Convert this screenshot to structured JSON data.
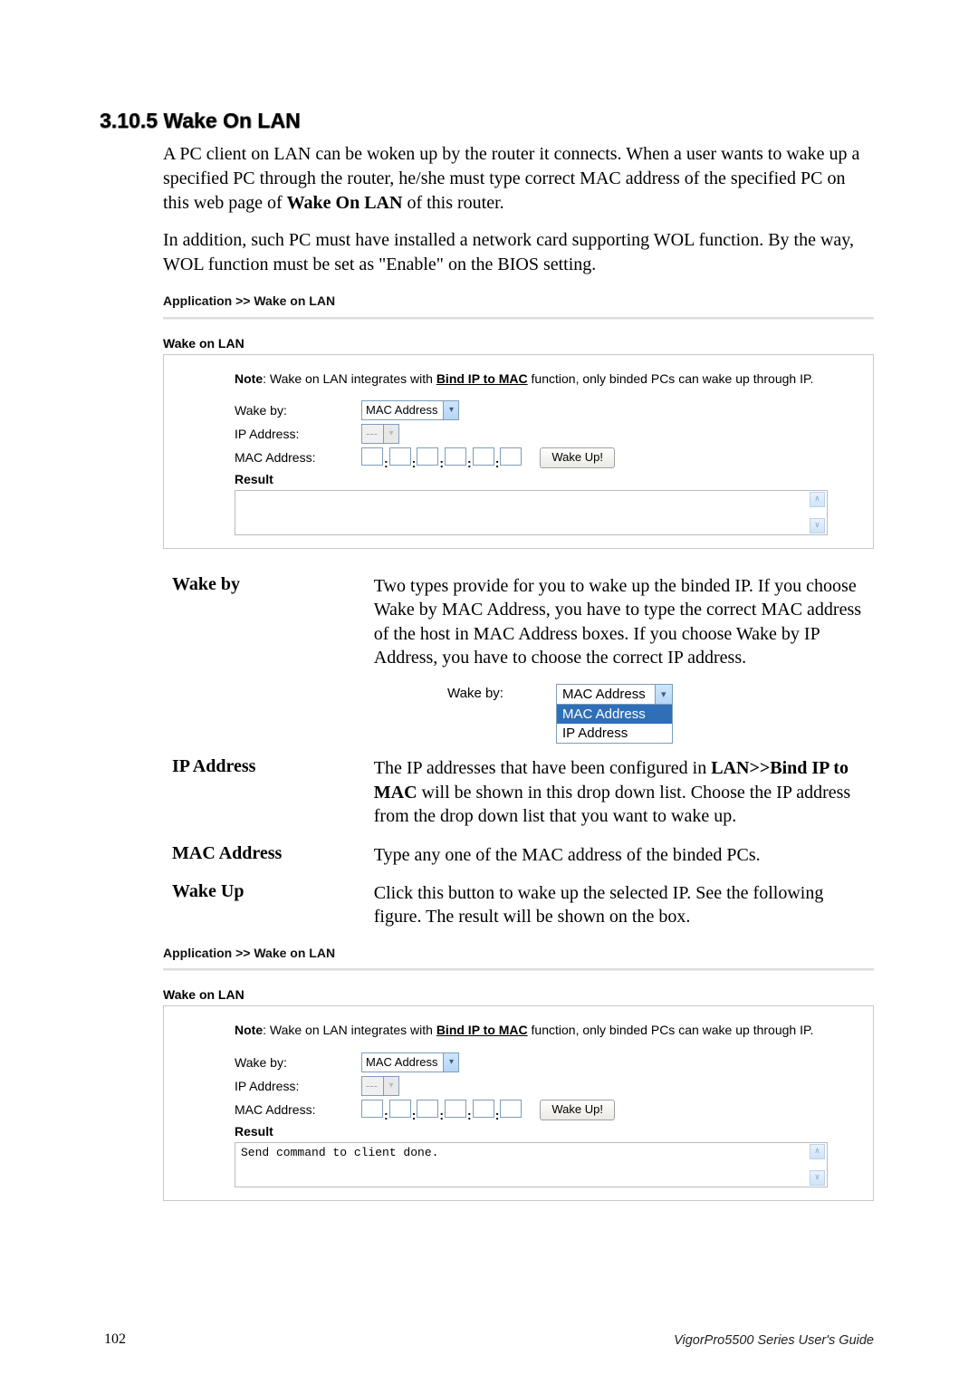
{
  "heading": "3.10.5 Wake On LAN",
  "para1_a": "A PC client on LAN can be woken up by the router it connects. When a user wants to wake up a specified PC through the router, he/she must type correct MAC address of the specified PC on this web page of ",
  "para1_bold": "Wake On LAN",
  "para1_b": " of this router.",
  "para2": "In addition, such PC must have installed a network card supporting WOL function. By the way, WOL function must be set as \"Enable\" on the BIOS setting.",
  "breadcrumb": "Application >> Wake on LAN",
  "panel_title": "Wake on LAN",
  "note_label": "Note",
  "note_a": ": Wake on LAN integrates with ",
  "note_link": "Bind IP to MAC",
  "note_b": " function,  only binded PCs can wake up through IP.",
  "labels": {
    "wake_by": "Wake by:",
    "ip_address": "IP Address:",
    "mac_address": "MAC Address:",
    "result": "Result"
  },
  "selects": {
    "wake_by_value": "MAC Address",
    "ip_value": "---",
    "dd_opts": [
      "MAC Address",
      "IP Address"
    ]
  },
  "buttons": {
    "wake_up": "Wake Up!"
  },
  "defs": {
    "wake_by": "Two types provide for you to wake up the binded IP. If you choose Wake by MAC Address, you have to type the correct MAC address of the host in MAC Address boxes. If you choose Wake by IP Address, you have to choose the correct IP address.",
    "ip_a": "The IP addresses that have been configured in ",
    "ip_bold1": "LAN>>Bind IP to MAC",
    "ip_b": " will be shown in this drop down list. Choose the IP address from the drop down list that you want to wake up.",
    "mac": "Type any one of the MAC address of the binded PCs.",
    "wakeup": "Click this button to wake up the selected IP. See the following figure. The result will be shown on the box."
  },
  "terms": {
    "wake_by": "Wake by",
    "ip": "IP Address",
    "mac": "MAC Address",
    "wakeup": "Wake Up"
  },
  "result2_text": "Send command to client done.",
  "footer": {
    "page": "102",
    "title": "VigorPro5500  Series  User's Guide"
  }
}
